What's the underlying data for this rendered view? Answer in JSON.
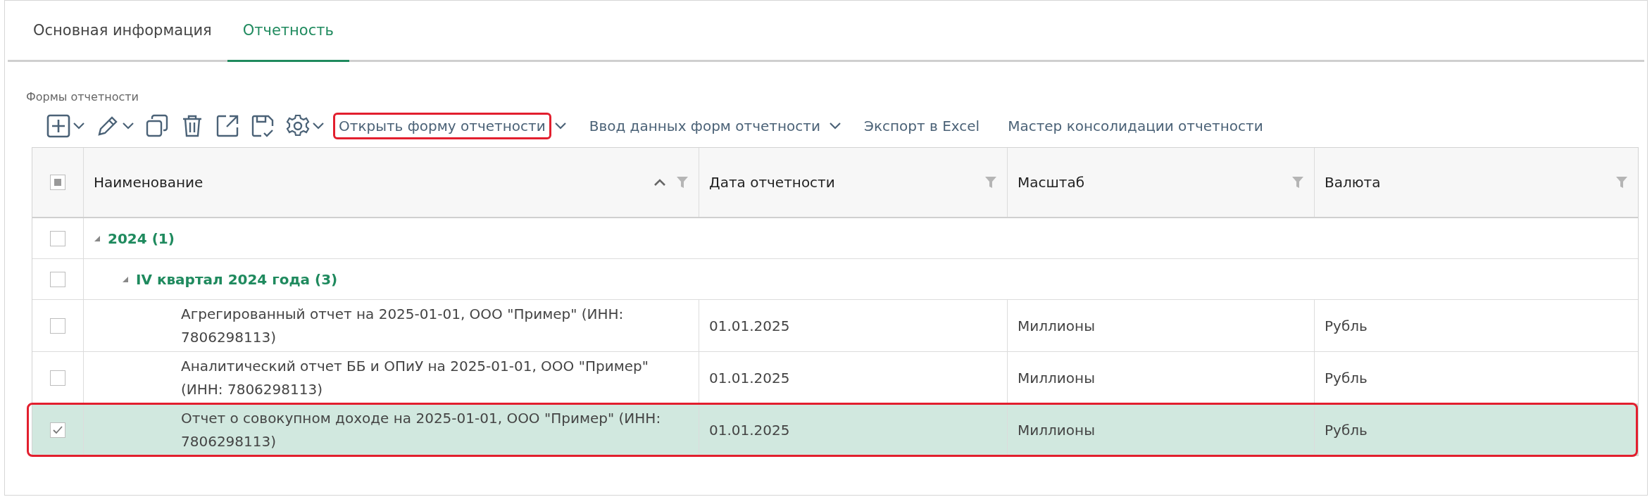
{
  "tabs": [
    {
      "label": "Основная информация",
      "selected": false
    },
    {
      "label": "Отчетность",
      "selected": true
    }
  ],
  "section_title": "Формы отчетности",
  "toolbar": {
    "icons": [
      {
        "kind": "add",
        "dropdown": true
      },
      {
        "kind": "edit",
        "dropdown": true
      },
      {
        "kind": "copy",
        "dropdown": false
      },
      {
        "kind": "delete",
        "dropdown": false
      },
      {
        "kind": "export",
        "dropdown": false
      },
      {
        "kind": "save",
        "dropdown": false
      },
      {
        "kind": "settings",
        "dropdown": true
      }
    ],
    "actions": [
      {
        "label": "Открыть форму отчетности",
        "dropdown": true,
        "highlighted": true
      },
      {
        "label": "Ввод данных форм отчетности",
        "dropdown": true,
        "highlighted": false
      },
      {
        "label": "Экспорт в Excel",
        "dropdown": false,
        "highlighted": false
      },
      {
        "label": "Мастер консолидации отчетности",
        "dropdown": false,
        "highlighted": false
      }
    ]
  },
  "table": {
    "select_all": {
      "indeterminate": true
    },
    "columns": [
      {
        "label": "Наименование",
        "sorted_ascending": true
      },
      {
        "label": "Дата отчетности",
        "sorted_ascending": false
      },
      {
        "label": "Масштаб",
        "sorted_ascending": false
      },
      {
        "label": "Валюта",
        "sorted_ascending": false
      }
    ],
    "rows": [
      {
        "kind": "group",
        "label": "2024 (1)",
        "expanded": true,
        "checked": false,
        "children": [
          {
            "kind": "group",
            "label": "IV квартал 2024 года (3)",
            "expanded": true,
            "checked": false,
            "children": [
              {
                "kind": "item",
                "name": "Агрегированный отчет на 2025-01-01, ООО \"Пример\" (ИНН: 7806298113)",
                "date": "01.01.2025",
                "scale": "Миллионы",
                "currency": "Рубль",
                "checked": false,
                "selected": false,
                "highlighted": false
              },
              {
                "kind": "item",
                "name": "Аналитический отчет ББ и ОПиУ на 2025-01-01, ООО \"Пример\" (ИНН: 7806298113)",
                "date": "01.01.2025",
                "scale": "Миллионы",
                "currency": "Рубль",
                "checked": false,
                "selected": false,
                "highlighted": false
              },
              {
                "kind": "item",
                "name": "Отчет о совокупном доходе на 2025-01-01, ООО \"Пример\" (ИНН: 7806298113)",
                "date": "01.01.2025",
                "scale": "Миллионы",
                "currency": "Рубль",
                "checked": true,
                "selected": true,
                "highlighted": true
              }
            ]
          }
        ]
      }
    ]
  }
}
